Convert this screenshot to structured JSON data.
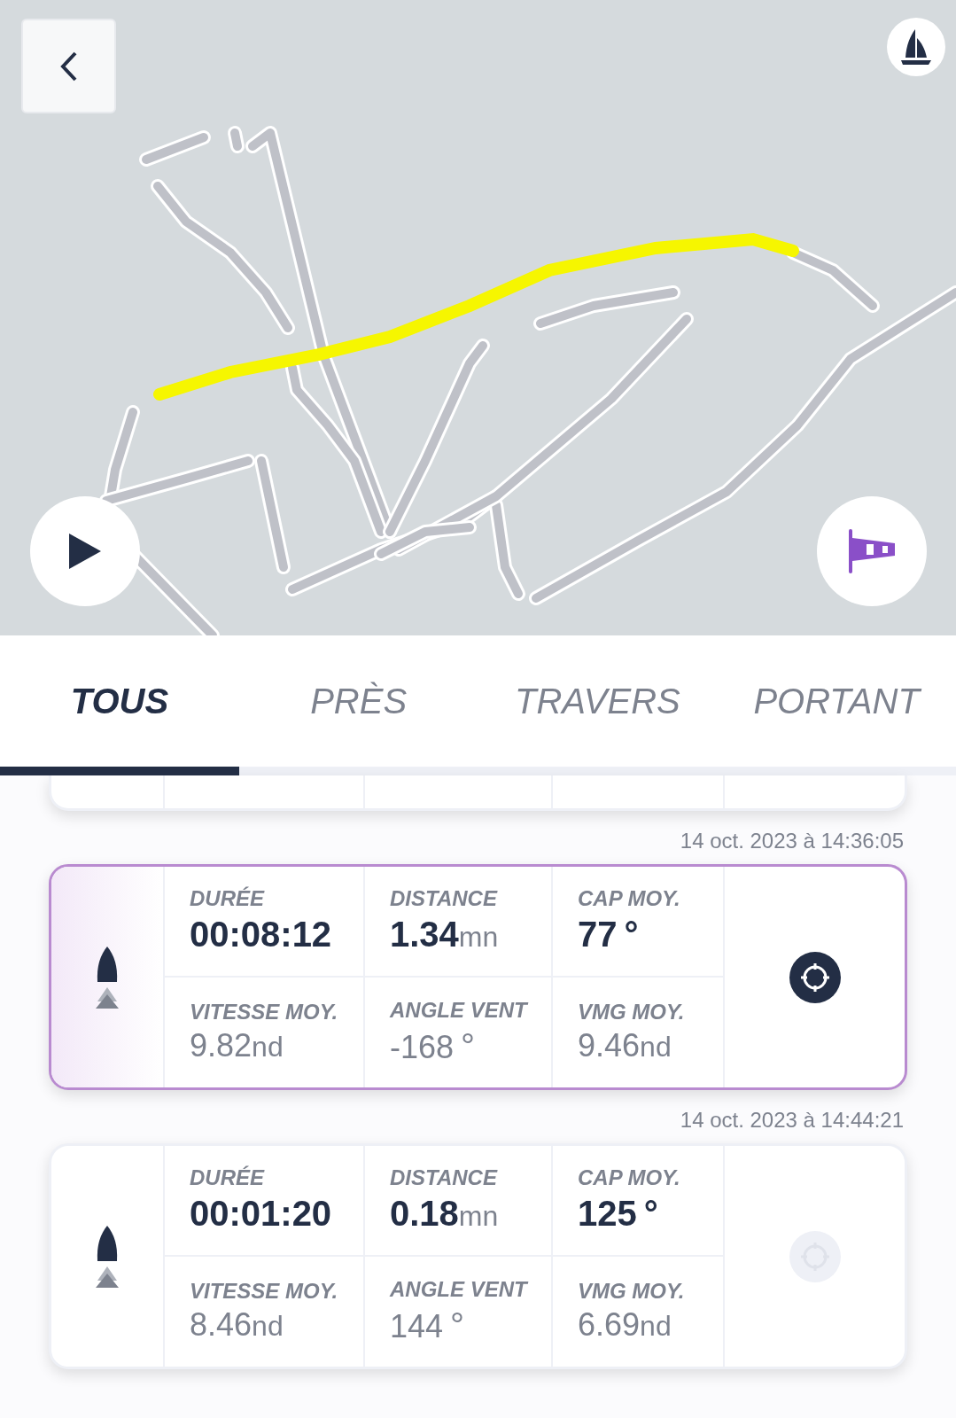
{
  "tabs": [
    {
      "label": "TOUS",
      "selected": true
    },
    {
      "label": "PRÈS",
      "selected": false
    },
    {
      "label": "TRAVERS",
      "selected": false
    },
    {
      "label": "PORTANT",
      "selected": false
    }
  ],
  "segments": [
    {
      "date": "14 oct. 2023 à 14:36:05",
      "selected": true,
      "stats": [
        {
          "label": "DURÉE",
          "value": "00:08:12"
        },
        {
          "label": "DISTANCE",
          "value": "1.34",
          "unit": "mn"
        },
        {
          "label": "CAP MOY.",
          "value": "77",
          "unit": "°"
        },
        {
          "label": "VITESSE MOY.",
          "value": "9.82",
          "unit": "nd"
        },
        {
          "label": "ANGLE VENT",
          "value": "-168",
          "unit": "°"
        },
        {
          "label": "VMG MOY.",
          "value": "9.46",
          "unit": "nd"
        }
      ]
    },
    {
      "date": "14 oct. 2023 à 14:44:21",
      "selected": false,
      "stats": [
        {
          "label": "DURÉE",
          "value": "00:01:20"
        },
        {
          "label": "DISTANCE",
          "value": "0.18",
          "unit": "mn"
        },
        {
          "label": "CAP MOY.",
          "value": "125",
          "unit": "°"
        },
        {
          "label": "VITESSE MOY.",
          "value": "8.46",
          "unit": "nd"
        },
        {
          "label": "ANGLE VENT",
          "value": "144",
          "unit": "°"
        },
        {
          "label": "VMG MOY.",
          "value": "6.69",
          "unit": "nd"
        }
      ]
    }
  ]
}
